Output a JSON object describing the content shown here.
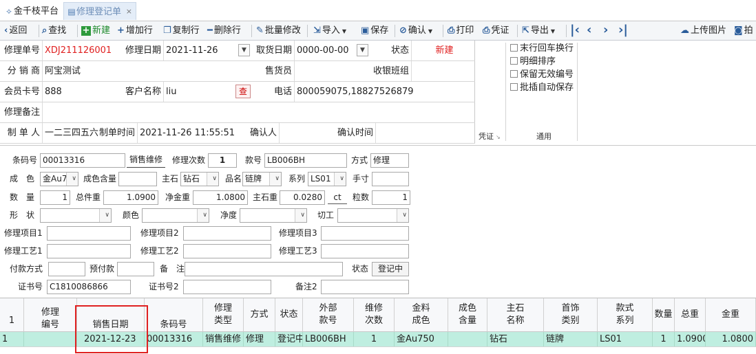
{
  "tabs": [
    {
      "label": "金千枝平台",
      "icon": "home-icon"
    },
    {
      "label": "修理登记单",
      "icon": "form-icon",
      "close": "×"
    }
  ],
  "toolbar": {
    "back": "返回",
    "search": "查找",
    "new": "新建",
    "add_row": "增加行",
    "copy_row": "复制行",
    "delete_row": "删除行",
    "batch_edit": "批量修改",
    "import": "导入",
    "save": "保存",
    "confirm": "确认",
    "print": "打印",
    "voucher": "凭证",
    "export": "导出",
    "upload": "上传图片",
    "photo": "拍"
  },
  "header": {
    "repair_no_label": "修理单号",
    "repair_no": "XDJ211126001",
    "repair_date_label": "修理日期",
    "repair_date": "2021-11-26",
    "pickup_date_label": "取货日期",
    "pickup_date": "0000-00-00",
    "status_label": "状态",
    "status": "新建",
    "distributor_label": "分 销 商",
    "distributor": "阿宝测试",
    "salesperson_label": "售货员",
    "salesperson": "",
    "cashier_group_label": "收银班组",
    "cashier_group": "",
    "member_card_label": "会员卡号",
    "member_card": "888",
    "customer_name_label": "客户名称",
    "customer_name": "liu",
    "lookup": "查",
    "phone_label": "电话",
    "phone": "800059075,18827526879",
    "remark_label": "修理备注",
    "remark": "",
    "maker_label": "制 单 人",
    "maker": "一二三四五六",
    "make_time_label": "制单时间",
    "make_time": "2021-11-26 11:55:51",
    "confirmer_label": "确认人",
    "confirmer": "",
    "confirm_time_label": "确认时间",
    "confirm_time": ""
  },
  "options": {
    "opt1": "末行回车换行",
    "opt2": "明细排序",
    "opt3": "保留无效编号",
    "opt4": "批插自动保存",
    "group_voucher": "凭证",
    "group_general": "通用"
  },
  "detail": {
    "barcode_label": "条码号",
    "barcode": "00013316",
    "sale_repair_btn": "销售维修",
    "repair_times_label": "修理次数",
    "repair_times": "1",
    "style_no_label": "款号",
    "style_no": "LB006BH",
    "method_label": "方式",
    "method": "修理",
    "color_label": "成　色",
    "color": "金Au7",
    "color_content_label": "成色含量",
    "color_content": "",
    "main_stone_label": "主石",
    "main_stone": "钻石",
    "product_label": "品名",
    "product": "链牌",
    "series_label": "系列",
    "series": "LS01",
    "size_label": "手寸",
    "size": "",
    "qty_label": "数　量",
    "qty": "1",
    "gross_weight_label": "总件重",
    "gross_weight": "1.0900",
    "net_gold_label": "净金重",
    "net_gold": "1.0800",
    "stone_weight_label": "主石重",
    "stone_weight": "0.0280",
    "stone_unit": "ct",
    "grain_count_label": "粒数",
    "grain_count": "1",
    "shape_label": "形　状",
    "shape": "",
    "color2_label": "颜色",
    "color2": "",
    "clarity_label": "净度",
    "clarity": "",
    "cut_label": "切工",
    "cut": "",
    "item1_label": "修理项目1",
    "item1": "",
    "item2_label": "修理项目2",
    "item2": "",
    "item3_label": "修理项目3",
    "item3": "",
    "craft1_label": "修理工艺1",
    "craft1": "",
    "craft2_label": "修理工艺2",
    "craft2": "",
    "craft3_label": "修理工艺3",
    "craft3": "",
    "pay_method_label": "付款方式",
    "pay_method": "",
    "prepay_label": "预付款",
    "prepay": "",
    "note_label": "备　注",
    "note": "",
    "status_label": "状态",
    "status": "登记中",
    "cert_label": "证书号",
    "cert": "C1810086866",
    "cert2_label": "证书号2",
    "cert2": "",
    "note2_label": "备注2",
    "note2": ""
  },
  "grid": {
    "headers": [
      "1",
      "修理\n编号",
      "销售日期",
      "条码号",
      "修理\n类型",
      "方式",
      "状态",
      "外部\n款号",
      "维修\n次数",
      "金料\n成色",
      "成色\n含量",
      "主石\n名称",
      "首饰\n类别",
      "款式\n系列",
      "数量",
      "总重",
      "金重"
    ],
    "row": [
      "1",
      "",
      "2021-12-23",
      "00013316",
      "销售维修",
      "修理",
      "登记中",
      "LB006BH",
      "1",
      "金Au750",
      "",
      "钻石",
      "链牌",
      "LS01",
      "1",
      "1.0900",
      "1.0800"
    ]
  }
}
